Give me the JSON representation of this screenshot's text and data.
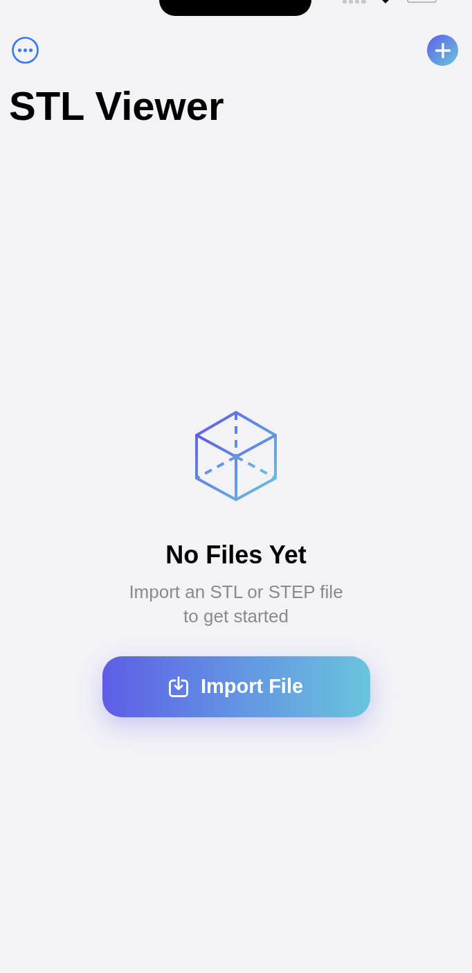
{
  "title": "STL Viewer",
  "empty_state": {
    "heading": "No Files Yet",
    "message": "Import an STL or STEP file to get started",
    "button": "Import File"
  }
}
